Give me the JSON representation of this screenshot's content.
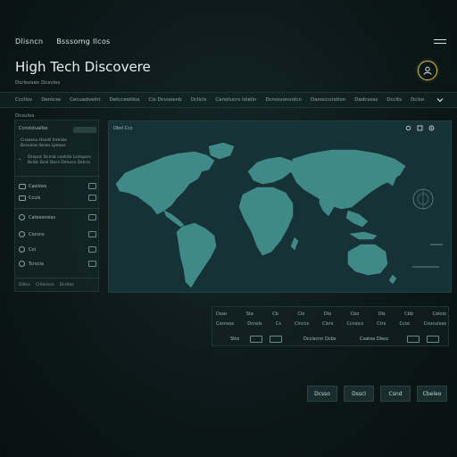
{
  "header": {
    "brand_left": "Dlisncn",
    "brand_right": "Bsssomg Ilcos",
    "title": "High Tech Discovere",
    "subtitle": "Dcrlsvoen   Dcsvlos"
  },
  "nav": {
    "section_label": "Dcsulos",
    "items": [
      "Cccllos",
      "Denlcse",
      "Cecuadvelnt",
      "Detcceotlios",
      "Cis Dcvsoenb",
      "Dclicls",
      "Canotucrs Istelin",
      "Dcrsovonvolcn",
      "Dansccurstlon",
      "Dadcsoss",
      "Dcclts",
      "Dclso"
    ]
  },
  "sidebar": {
    "heading": "Ccnsistuallos",
    "rows": [
      "Cnaosnu   Hsortl   Inmisio",
      "Bcsnsios   Ibceo  Lpeous"
    ],
    "desc": [
      "Dsspoc  Dcnsb  cootdsi  Lsimpors",
      "Bclsb  Dcel  Docs  Ddnusn  Dslcss"
    ],
    "options": [
      {
        "label": "Casiloss",
        "type": "check"
      },
      {
        "label": "Ccuis",
        "type": "check"
      },
      {
        "label": "Catesonsias",
        "type": "radio"
      },
      {
        "label": "Cocsns",
        "type": "radio"
      },
      {
        "label": "Coi",
        "type": "radio"
      },
      {
        "label": "Tcrscia",
        "type": "radio"
      }
    ],
    "footer": [
      "Diltco",
      "Crllonsco",
      "Dccllos"
    ]
  },
  "map": {
    "header": "Dbsl   Ccs"
  },
  "data_strip": {
    "row1": [
      "Dsso",
      "Sta",
      "Cb",
      "Clo",
      "Dlo",
      "Cbo",
      "Dls",
      "Cbb",
      "Coloio"
    ],
    "row2": [
      "Cssnsos",
      "Dcnsls",
      "Cs",
      "Clnccs",
      "Clsrs",
      "Ccnsics",
      "Ctrs",
      "Ccoc",
      "Cnoculsas"
    ],
    "ctrl": [
      "Stto",
      "Dcclscnn Dcbs",
      "Csatoa Dlesc"
    ]
  },
  "buttons": [
    "Dcsso",
    "Dsscl",
    "Csnd",
    "Cbeleo"
  ],
  "colors": {
    "accent_yellow": "#d8c449",
    "map_land": "#3f8a89",
    "panel_bg": "#173236"
  }
}
